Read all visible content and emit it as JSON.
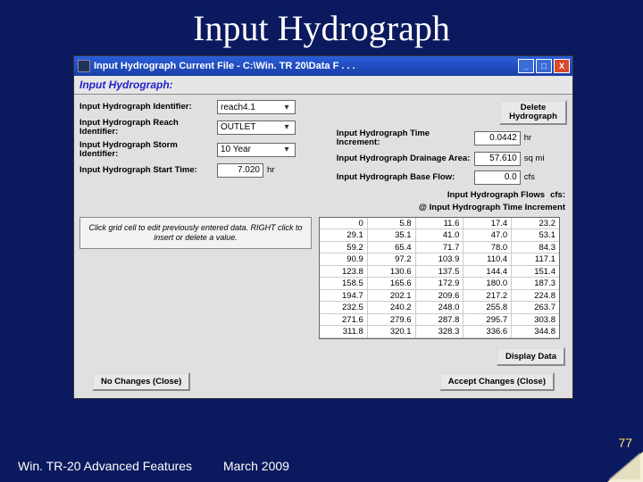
{
  "slide": {
    "title": "Input Hydrograph"
  },
  "titlebar": {
    "text": "Input Hydrograph    Current File  -  C:\\Win. TR 20\\Data F . . ."
  },
  "subheader": "Input Hydrograph:",
  "labels": {
    "identifier": "Input Hydrograph Identifier:",
    "reach": "Input Hydrograph Reach Identifier:",
    "storm": "Input Hydrograph Storm Identifier:",
    "start": "Input Hydrograph Start Time:",
    "increment": "Input Hydrograph Time Increment:",
    "drainage": "Input Hydrograph Drainage Area:",
    "baseflow": "Input Hydrograph Base Flow:"
  },
  "values": {
    "identifier": "reach4.1",
    "reach": "OUTLET",
    "storm": "10 Year",
    "start": "7.020",
    "increment": "0.0442",
    "drainage": "57.610",
    "baseflow": "0.0"
  },
  "units": {
    "start": "hr",
    "increment": "hr",
    "drainage": "sq mi",
    "baseflow": "cfs"
  },
  "buttons": {
    "delete": "Delete Hydrograph",
    "display": "Display Data",
    "noChanges": "No Changes (Close)",
    "accept": "Accept Changes (Close)"
  },
  "flowHeader": {
    "label": "Input Hydrograph Flows",
    "unit": "cfs:"
  },
  "rowHeader": "@ Input Hydrograph Time Increment",
  "hint": "Click grid cell to edit previously entered data. RIGHT click to insert or delete a value.",
  "chart_data": {
    "type": "table",
    "title": "Input Hydrograph Flows (cfs) @ Time Increment",
    "columns": 5,
    "values": [
      [
        0,
        5.8,
        11.6,
        17.4,
        23.2
      ],
      [
        29.1,
        35.1,
        41.0,
        47.0,
        53.1
      ],
      [
        59.2,
        65.4,
        71.7,
        78.0,
        84.3
      ],
      [
        90.9,
        97.2,
        103.9,
        110.4,
        117.1
      ],
      [
        123.8,
        130.6,
        137.5,
        144.4,
        151.4
      ],
      [
        158.5,
        165.6,
        172.9,
        180.0,
        187.3
      ],
      [
        194.7,
        202.1,
        209.6,
        217.2,
        224.8
      ],
      [
        232.5,
        240.2,
        248.0,
        255.8,
        263.7
      ],
      [
        271.6,
        279.6,
        287.8,
        295.7,
        303.8
      ],
      [
        311.8,
        320.1,
        328.3,
        336.6,
        344.8
      ]
    ]
  },
  "footer": {
    "left": "Win. TR-20 Advanced Features",
    "mid": "March 2009",
    "page": "77"
  }
}
